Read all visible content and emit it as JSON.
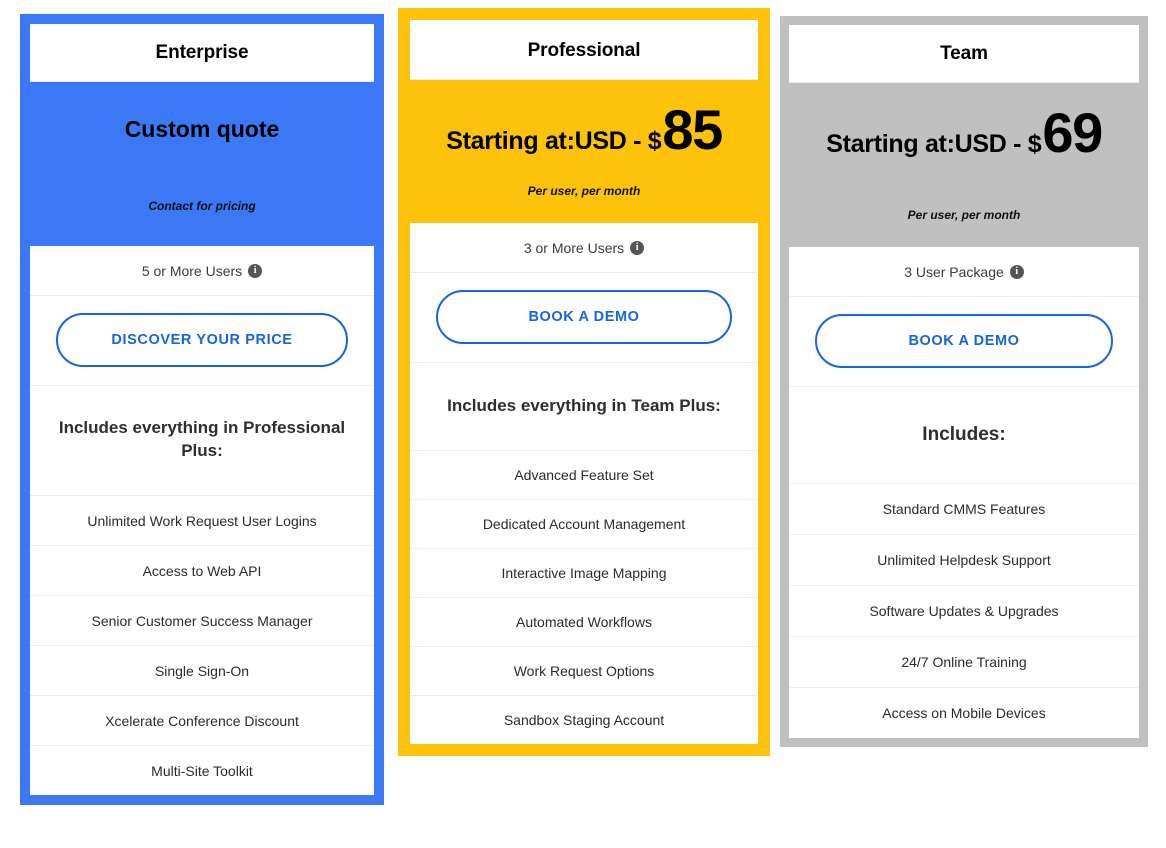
{
  "colors": {
    "enterprise_accent": "#3b78f5",
    "professional_accent": "#fdc20a",
    "team_accent": "#c0c0c0",
    "cta_blue": "#1664e0",
    "separator": "#ececec"
  },
  "plans": [
    {
      "id": "enterprise",
      "title": "Enterprise",
      "price_prefix": "",
      "price_amount": "",
      "custom_quote": "Custom quote",
      "price_note": "Contact for pricing",
      "users_label": "5 or More Users",
      "info_icon": "info-icon",
      "info_glyph": "i",
      "cta_label": "DISCOVER YOUR PRICE",
      "includes_heading": "Includes everything in Professional Plus:",
      "features": [
        "Unlimited Work Request User Logins",
        "Access to Web API",
        "Senior Customer Success Manager",
        "Single Sign-On",
        "Xcelerate Conference Discount",
        "Multi-Site Toolkit"
      ]
    },
    {
      "id": "professional",
      "title": "Professional",
      "price_prefix": "Starting at:USD - $",
      "price_amount": "85",
      "custom_quote": "",
      "price_note": "Per user, per month",
      "users_label": "3 or More Users",
      "info_icon": "info-icon",
      "info_glyph": "i",
      "cta_label": "BOOK A DEMO",
      "includes_heading": "Includes everything in Team Plus:",
      "features": [
        "Advanced Feature Set",
        "Dedicated Account Management",
        "Interactive Image Mapping",
        "Automated Workflows",
        "Work Request Options",
        "Sandbox Staging Account"
      ]
    },
    {
      "id": "team",
      "title": "Team",
      "price_prefix": "Starting at:USD - $",
      "price_amount": "69",
      "custom_quote": "",
      "price_note": "Per user, per month",
      "users_label": "3 User Package",
      "info_icon": "info-icon",
      "info_glyph": "i",
      "cta_label": "BOOK A DEMO",
      "includes_heading": "Includes:",
      "features": [
        "Standard CMMS Features",
        "Unlimited Helpdesk Support",
        "Software Updates & Upgrades",
        "24/7 Online Training",
        "Access on Mobile Devices"
      ]
    }
  ]
}
